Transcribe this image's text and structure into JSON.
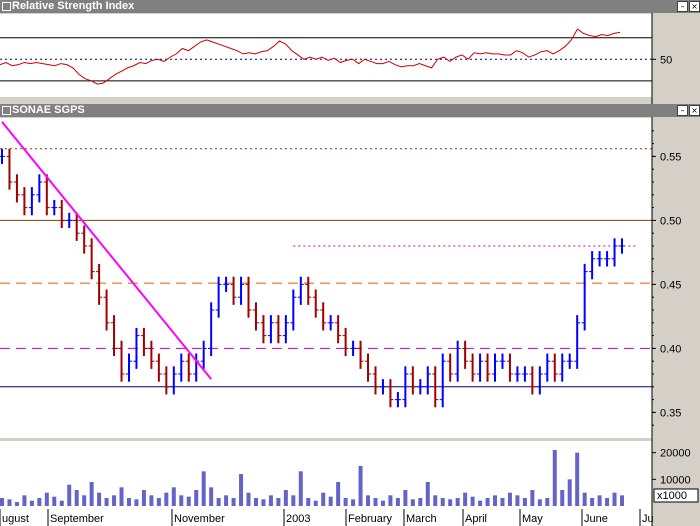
{
  "chart_data": [
    {
      "type": "line",
      "title": "Relative Strength Index",
      "yticks": [
        50
      ],
      "reference_lines": [
        {
          "y": 70,
          "style": "solid",
          "color": "#000000"
        },
        {
          "y": 50,
          "style": "dotted",
          "color": "#000080"
        },
        {
          "y": 30,
          "style": "solid",
          "color": "#000000"
        }
      ],
      "series": [
        {
          "color": "#cc0000",
          "values": [
            45,
            47,
            44,
            45,
            47,
            46,
            47,
            46,
            45,
            44,
            46,
            45,
            42,
            36,
            32,
            30,
            27,
            28,
            32,
            36,
            39,
            42,
            44,
            47,
            46,
            49,
            50,
            48,
            52,
            55,
            60,
            58,
            62,
            66,
            68,
            66,
            64,
            62,
            60,
            58,
            55,
            56,
            55,
            57,
            58,
            62,
            67,
            64,
            58,
            54,
            50,
            52,
            50,
            52,
            49,
            51,
            47,
            49,
            50,
            46,
            50,
            48,
            46,
            46,
            48,
            45,
            43,
            44,
            44,
            46,
            44,
            42,
            50,
            52,
            48,
            52,
            54,
            50,
            56,
            55,
            56,
            55,
            55,
            54,
            54,
            58,
            56,
            52,
            54,
            57,
            58,
            55,
            58,
            62,
            68,
            78,
            74,
            72,
            71,
            73,
            72,
            74,
            75
          ]
        }
      ]
    },
    {
      "type": "bar",
      "title": "SONAE SGPS",
      "yticks": [
        0.35,
        0.4,
        0.45,
        0.5,
        0.55
      ],
      "ylim": [
        0.33,
        0.58
      ],
      "x_axis_labels": [
        "ugust",
        "September",
        "November",
        "2003",
        "February",
        "March",
        "April",
        "May",
        "June",
        "Ju"
      ],
      "reference_lines": [
        {
          "y": 0.556,
          "style": "dotted",
          "color": "#804000"
        },
        {
          "y": 0.5,
          "style": "solid",
          "color": "#804000"
        },
        {
          "y": 0.451,
          "style": "dashed",
          "color": "#e06000"
        },
        {
          "y": 0.4,
          "style": "dashed",
          "color": "#c000c0"
        },
        {
          "y": 0.37,
          "style": "solid",
          "color": "#000080"
        },
        {
          "y": 0.48,
          "style": "dotted",
          "color": "#c000c0",
          "start_index": 39
        }
      ],
      "trend_line": {
        "from": [
          0,
          0.577
        ],
        "to": [
          28,
          0.376
        ],
        "color": "#ff00ff"
      },
      "up_color": "#0000ff",
      "down_color": "#a00000",
      "series": [
        {
          "name": "close",
          "values": [
            0.55,
            0.53,
            0.52,
            0.51,
            0.52,
            0.53,
            0.51,
            0.51,
            0.5,
            0.5,
            0.49,
            0.48,
            0.46,
            0.44,
            0.42,
            0.4,
            0.38,
            0.39,
            0.41,
            0.4,
            0.39,
            0.38,
            0.37,
            0.38,
            0.39,
            0.38,
            0.39,
            0.4,
            0.43,
            0.45,
            0.45,
            0.44,
            0.45,
            0.43,
            0.42,
            0.41,
            0.42,
            0.41,
            0.42,
            0.44,
            0.45,
            0.44,
            0.43,
            0.42,
            0.42,
            0.41,
            0.4,
            0.4,
            0.39,
            0.38,
            0.37,
            0.37,
            0.36,
            0.36,
            0.38,
            0.37,
            0.37,
            0.38,
            0.36,
            0.39,
            0.38,
            0.4,
            0.39,
            0.38,
            0.39,
            0.38,
            0.39,
            0.39,
            0.38,
            0.38,
            0.38,
            0.37,
            0.38,
            0.39,
            0.38,
            0.39,
            0.39,
            0.42,
            0.46,
            0.47,
            0.47,
            0.47,
            0.48,
            0.48
          ]
        }
      ]
    },
    {
      "type": "bar",
      "yticks": [
        10000,
        20000
      ],
      "unit_label": "x1000",
      "series": [
        {
          "color": "#6464c8",
          "values": [
            3000,
            2500,
            1500,
            4000,
            2000,
            3000,
            5000,
            3500,
            2000,
            8000,
            6000,
            4000,
            9000,
            5000,
            3000,
            4000,
            7000,
            3000,
            2500,
            6000,
            4000,
            3000,
            5000,
            7000,
            4000,
            3500,
            6000,
            13000,
            7000,
            3000,
            4000,
            3000,
            12000,
            5000,
            3000,
            2500,
            4000,
            3000,
            6000,
            4000,
            13000,
            3000,
            2000,
            5000,
            3500,
            9000,
            3000,
            2500,
            15000,
            4000,
            3000,
            2000,
            4000,
            3000,
            6000,
            2500,
            3000,
            9000,
            4000,
            3000,
            2500,
            3000,
            5000,
            3500,
            2000,
            3000,
            4000,
            3000,
            5000,
            4000,
            3000,
            6000,
            2500,
            3000,
            21000,
            6000,
            10000,
            20000,
            5000,
            3000,
            4000,
            3000,
            5000,
            4000
          ]
        }
      ]
    }
  ]
}
